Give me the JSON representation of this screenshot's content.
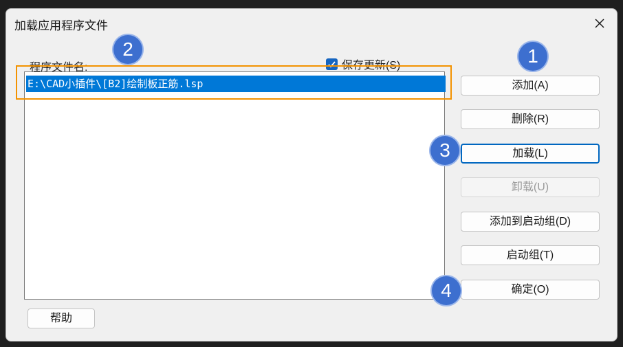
{
  "dialog": {
    "title": "加载应用程序文件",
    "file_list_label": "程序文件名:",
    "save_updates_label": "保存更新(S)",
    "save_updates_checked": true,
    "files": [
      "E:\\CAD小插件\\[B2]绘制板正筋.lsp"
    ],
    "selected_index": 0
  },
  "buttons": {
    "add": "添加(A)",
    "remove": "删除(R)",
    "load": "加载(L)",
    "unload": "卸载(U)",
    "add_to_startup": "添加到启动组(D)",
    "startup_group": "启动组(T)",
    "ok": "确定(O)",
    "help": "帮助"
  },
  "annotations": {
    "step1": "1",
    "step2": "2",
    "step3": "3",
    "step4": "4"
  },
  "colors": {
    "selection": "#0078d7",
    "annotation_box": "#f39200",
    "badge": "#3d6fcf"
  },
  "icons": {
    "close": "close-icon",
    "checkbox": "check-icon"
  }
}
